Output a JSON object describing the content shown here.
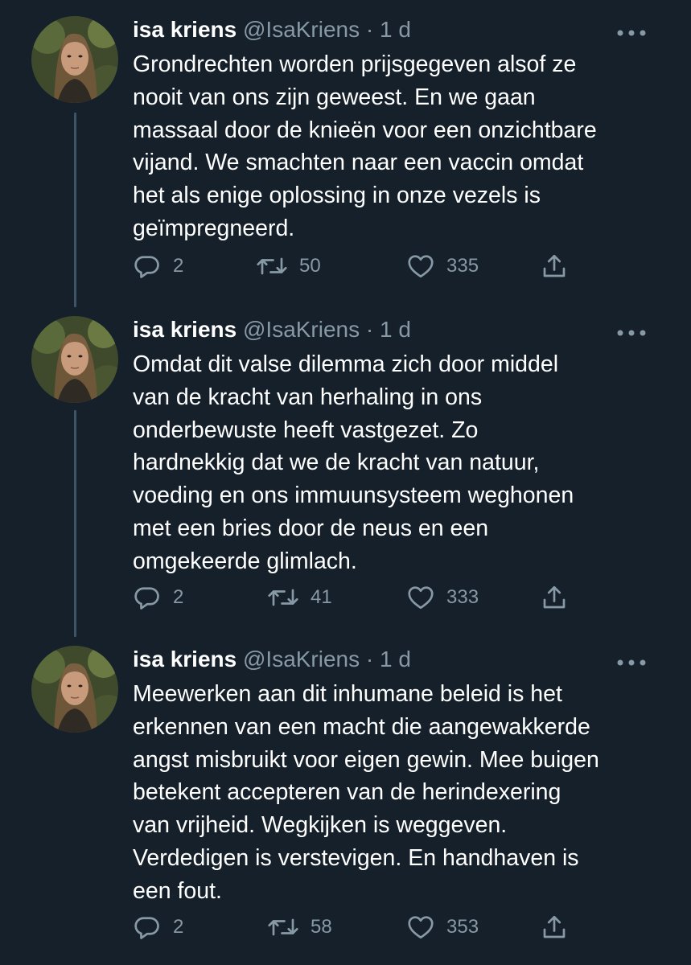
{
  "tweets": [
    {
      "name": "isa kriens",
      "handle": "@IsaKriens",
      "separator": "·",
      "time": "1 d",
      "text_lines": [
        "Grondrechten worden prijsgegeven alsof ze",
        "nooit van ons zijn geweest. En we gaan",
        "massaal door de knieën voor een onzichtbare",
        "vijand. We smachten naar een vaccin omdat",
        "het als enige oplossing in onze vezels is",
        "geïmpregneerd."
      ],
      "replies": "2",
      "retweets": "50",
      "likes": "335"
    },
    {
      "name": "isa kriens",
      "handle": "@IsaKriens",
      "separator": "·",
      "time": "1 d",
      "text_lines": [
        "Omdat dit valse dilemma zich door middel",
        "van de kracht van herhaling in ons",
        "onderbewuste heeft vastgezet. Zo",
        "hardnekkig dat we de kracht van natuur,",
        "voeding en ons immuunsysteem weghonen",
        "met een bries door de neus en een",
        "omgekeerde glimlach."
      ],
      "replies": "2",
      "retweets": "41",
      "likes": "333"
    },
    {
      "name": "isa kriens",
      "handle": "@IsaKriens",
      "separator": "·",
      "time": "1 d",
      "text_lines": [
        "Meewerken aan dit inhumane beleid is het",
        "erkennen van een macht die aangewakkerde",
        "angst misbruikt voor eigen gewin. Mee buigen",
        "betekent accepteren van de herindexering",
        "van vrijheid. Wegkijken is weggeven.",
        "Verdedigen is verstevigen. En handhaven is",
        "een fout."
      ],
      "replies": "2",
      "retweets": "58",
      "likes": "353"
    }
  ],
  "icons": {
    "reply": "reply-icon",
    "retweet": "retweet-icon",
    "like": "heart-icon",
    "share": "share-icon",
    "more": "more-options-icon"
  },
  "colors": {
    "background": "#15202b",
    "secondary_text": "#8899a6",
    "thread_line": "#3d5466"
  }
}
